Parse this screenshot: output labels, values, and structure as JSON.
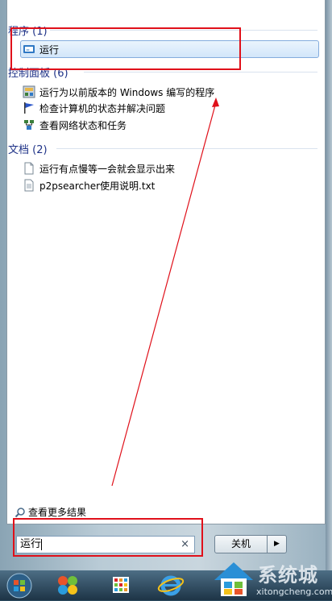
{
  "groups": {
    "programs": {
      "label": "程序 (1)"
    },
    "control_panel": {
      "label": "控制面板 (6)"
    },
    "documents": {
      "label": "文档 (2)"
    }
  },
  "programs": [
    {
      "label": "运行",
      "icon": "run-icon"
    }
  ],
  "control_panel": [
    {
      "label": "运行为以前版本的 Windows 编写的程序",
      "icon": "compat-icon"
    },
    {
      "label": "检查计算机的状态并解决问题",
      "icon": "flag-icon"
    },
    {
      "label": "查看网络状态和任务",
      "icon": "network-icon"
    }
  ],
  "documents": [
    {
      "label": "运行有点慢等一会就会显示出来",
      "icon": "document-icon"
    },
    {
      "label": "p2psearcher使用说明.txt",
      "icon": "text-file-icon"
    }
  ],
  "see_more": {
    "label": "查看更多结果",
    "icon": "search-icon"
  },
  "search": {
    "value": "运行",
    "clear": "×"
  },
  "shutdown": {
    "label": "关机",
    "arrow": "▶"
  },
  "watermark": {
    "brand": "系统城",
    "url": "xitongcheng.com"
  },
  "colors": {
    "accent": "#1e3287",
    "highlight": "#d2e6fa",
    "annotation": "#e0101a"
  }
}
